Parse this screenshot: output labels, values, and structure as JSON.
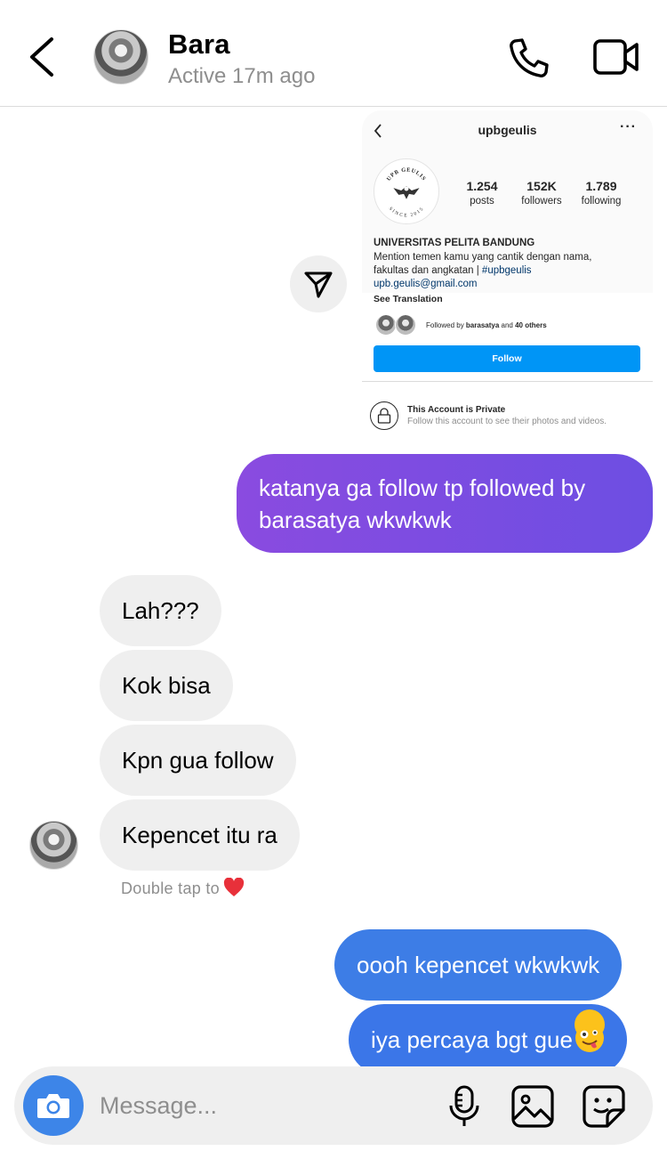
{
  "header": {
    "name": "Bara",
    "status": "Active 17m ago"
  },
  "shared_profile": {
    "username": "upbgeulis",
    "more": "···",
    "logo_text_top": "UPB GEULIS",
    "logo_text_bottom": "SINCE 2015",
    "stats": [
      {
        "number": "1.254",
        "label": "posts"
      },
      {
        "number": "152K",
        "label": "followers"
      },
      {
        "number": "1.789",
        "label": "following"
      }
    ],
    "full_name": "UNIVERSITAS PELITA BANDUNG",
    "bio_line1": "Mention temen kamu yang cantik dengan nama,",
    "bio_line2": "fakultas dan angkatan | ",
    "bio_tag": "#upbgeulis",
    "email": "upb.geulis@gmail.com",
    "see_translation": "See Translation",
    "followed_prefix": "Followed by ",
    "followed_user": "barasatya",
    "followed_mid": " and ",
    "followed_others": "40 others",
    "follow_button": "Follow",
    "private_title": "This Account is Private",
    "private_subtitle": "Follow this account to see their photos and videos."
  },
  "messages": [
    {
      "direction": "out",
      "text": "katanya ga follow tp followed by barasatya wkwkwk"
    },
    {
      "direction": "in",
      "text": "Lah???"
    },
    {
      "direction": "in",
      "text": "Kok bisa"
    },
    {
      "direction": "in",
      "text": "Kpn gua follow"
    },
    {
      "direction": "in",
      "text": "Kepencet itu ra"
    },
    {
      "direction": "out",
      "text": "oooh kepencet wkwkwk"
    },
    {
      "direction": "out",
      "text": "iya percaya bgt gue"
    }
  ],
  "double_tap_hint": "Double tap to",
  "composer": {
    "placeholder": "Message..."
  },
  "colors": {
    "outgoing_purple": "#7b4ee0",
    "outgoing_blue": "#3d7de6",
    "incoming_gray": "#efefef",
    "follow_blue": "#0095f6"
  }
}
